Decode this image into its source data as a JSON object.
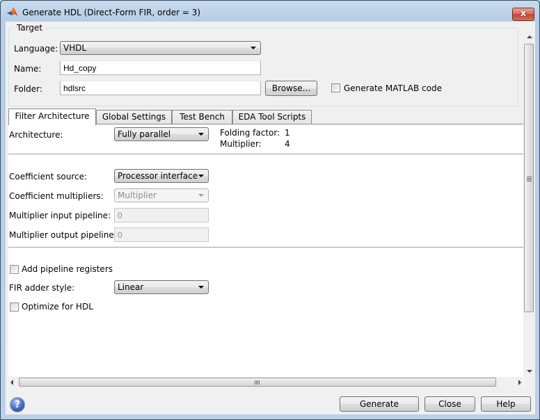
{
  "window": {
    "title": "Generate HDL (Direct-Form FIR, order = 3)",
    "close_label": "x"
  },
  "target": {
    "legend": "Target",
    "language_label": "Language:",
    "language_value": "VHDL",
    "name_label": "Name:",
    "name_value": "Hd_copy",
    "folder_label": "Folder:",
    "folder_value": "hdlsrc",
    "browse_label": "Browse...",
    "generate_matlab_label": "Generate MATLAB code",
    "generate_matlab_checked": false
  },
  "tabs": [
    {
      "label": "Filter Architecture",
      "active": true
    },
    {
      "label": "Global Settings",
      "active": false
    },
    {
      "label": "Test Bench",
      "active": false
    },
    {
      "label": "EDA Tool Scripts",
      "active": false
    }
  ],
  "filter_architecture": {
    "architecture_label": "Architecture:",
    "architecture_value": "Fully parallel",
    "folding_factor_label": "Folding factor:",
    "folding_factor_value": "1",
    "multiplier_label": "Multiplier:",
    "multiplier_value": "4",
    "coefficient_source_label": "Coefficient source:",
    "coefficient_source_value": "Processor interface",
    "coefficient_multipliers_label": "Coefficient multipliers:",
    "coefficient_multipliers_value": "Multiplier",
    "multiplier_input_pipeline_label": "Multiplier input pipeline:",
    "multiplier_input_pipeline_value": "0",
    "multiplier_output_pipeline_label": "Multiplier output pipeline:",
    "multiplier_output_pipeline_value": "0",
    "add_pipeline_registers_label": "Add pipeline registers",
    "add_pipeline_registers_checked": false,
    "fir_adder_style_label": "FIR adder style:",
    "fir_adder_style_value": "Linear",
    "optimize_for_hdl_label": "Optimize for HDL",
    "optimize_for_hdl_checked": false
  },
  "footer": {
    "help_icon_glyph": "?",
    "generate_label": "Generate",
    "close_label": "Close",
    "help_label": "Help"
  }
}
